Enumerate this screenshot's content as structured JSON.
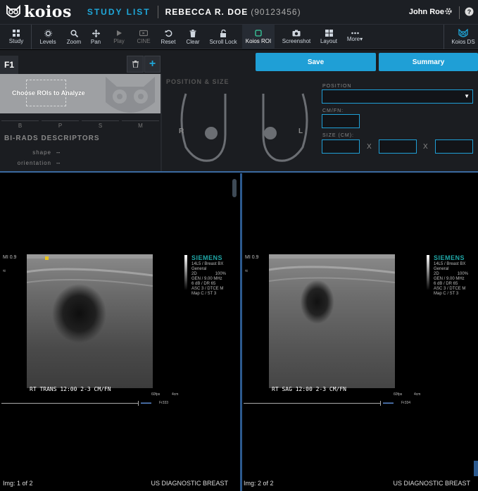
{
  "header": {
    "logo_text": "koios",
    "study_list": "STUDY LIST",
    "patient_name": "REBECCA R. DOE",
    "patient_id": "(90123456)",
    "user": "John Roe"
  },
  "toolbar": {
    "items": [
      {
        "label": "Study",
        "icon": "grid-icon"
      },
      {
        "label": "Levels",
        "icon": "sun-icon"
      },
      {
        "label": "Zoom",
        "icon": "search-icon"
      },
      {
        "label": "Pan",
        "icon": "move-icon"
      },
      {
        "label": "Play",
        "icon": "play-icon"
      },
      {
        "label": "CINE",
        "icon": "cine-icon"
      },
      {
        "label": "Reset",
        "icon": "reset-icon"
      },
      {
        "label": "Clear",
        "icon": "trash-icon"
      },
      {
        "label": "Scroll Lock",
        "icon": "lock-icon"
      },
      {
        "label": "Koios ROI",
        "icon": "roi-icon"
      },
      {
        "label": "Screenshot",
        "icon": "camera-icon"
      },
      {
        "label": "Layout",
        "icon": "layout-icon"
      },
      {
        "label": "More▾",
        "icon": "more-icon"
      },
      {
        "label": "Koios DS",
        "icon": "owl-icon"
      }
    ]
  },
  "finding": {
    "tab": "F1",
    "roi_prompt": "Choose ROIs to Analyze",
    "bpsm": [
      "B",
      "P",
      "S",
      "M"
    ],
    "birads_title": "BI-RADS DESCRIPTORS",
    "descriptors": [
      {
        "label": "shape",
        "value": "--"
      },
      {
        "label": "orientation",
        "value": "--"
      }
    ]
  },
  "position_size": {
    "title": "POSITION & SIZE",
    "right_label": "R",
    "left_label": "L",
    "position_label": "POSITION",
    "position_value": "",
    "cmfn_label": "CM/FN:",
    "size_label": "SIZE (CM):",
    "x": "X"
  },
  "actions": {
    "save": "Save",
    "summary": "Summary"
  },
  "viewports": [
    {
      "mi": "MI  0.9",
      "approx": "≈",
      "brand": "SIEMENS",
      "info": [
        "14L5 / Breast BX",
        "General",
        "2D",
        "GEN / 9.00 MHz",
        "6 dB / DR 65",
        "ASC 3 / DTCE M",
        "Map C / ST 3"
      ],
      "pct": "100%",
      "caption": "RT TRANS 12:00 2-3 CM/FN",
      "fps": "60fps",
      "depth": "4cm",
      "frame": "Fr333",
      "img_label": "Img: 1 of 2",
      "study_label": "US DIAGNOSTIC BREAST"
    },
    {
      "mi": "MI  0.9",
      "approx": "≈",
      "brand": "SIEMENS",
      "info": [
        "14L5 / Breast BX",
        "General",
        "2D",
        "GEN / 9.00 MHz",
        "6 dB / DR 65",
        "ASC 3 / DTCE M",
        "Map C / ST 3"
      ],
      "pct": "100%",
      "caption": "RT SAG 12:00 2-3 CM/FN",
      "fps": "60fps",
      "depth": "4cm",
      "frame": "Fr334",
      "img_label": "Img: 2 of 2",
      "study_label": "US DIAGNOSTIC BREAST"
    }
  ],
  "colors": {
    "accent": "#1f9fd6",
    "header_bg": "#1c1f24",
    "siemens": "#1fa7a7"
  }
}
